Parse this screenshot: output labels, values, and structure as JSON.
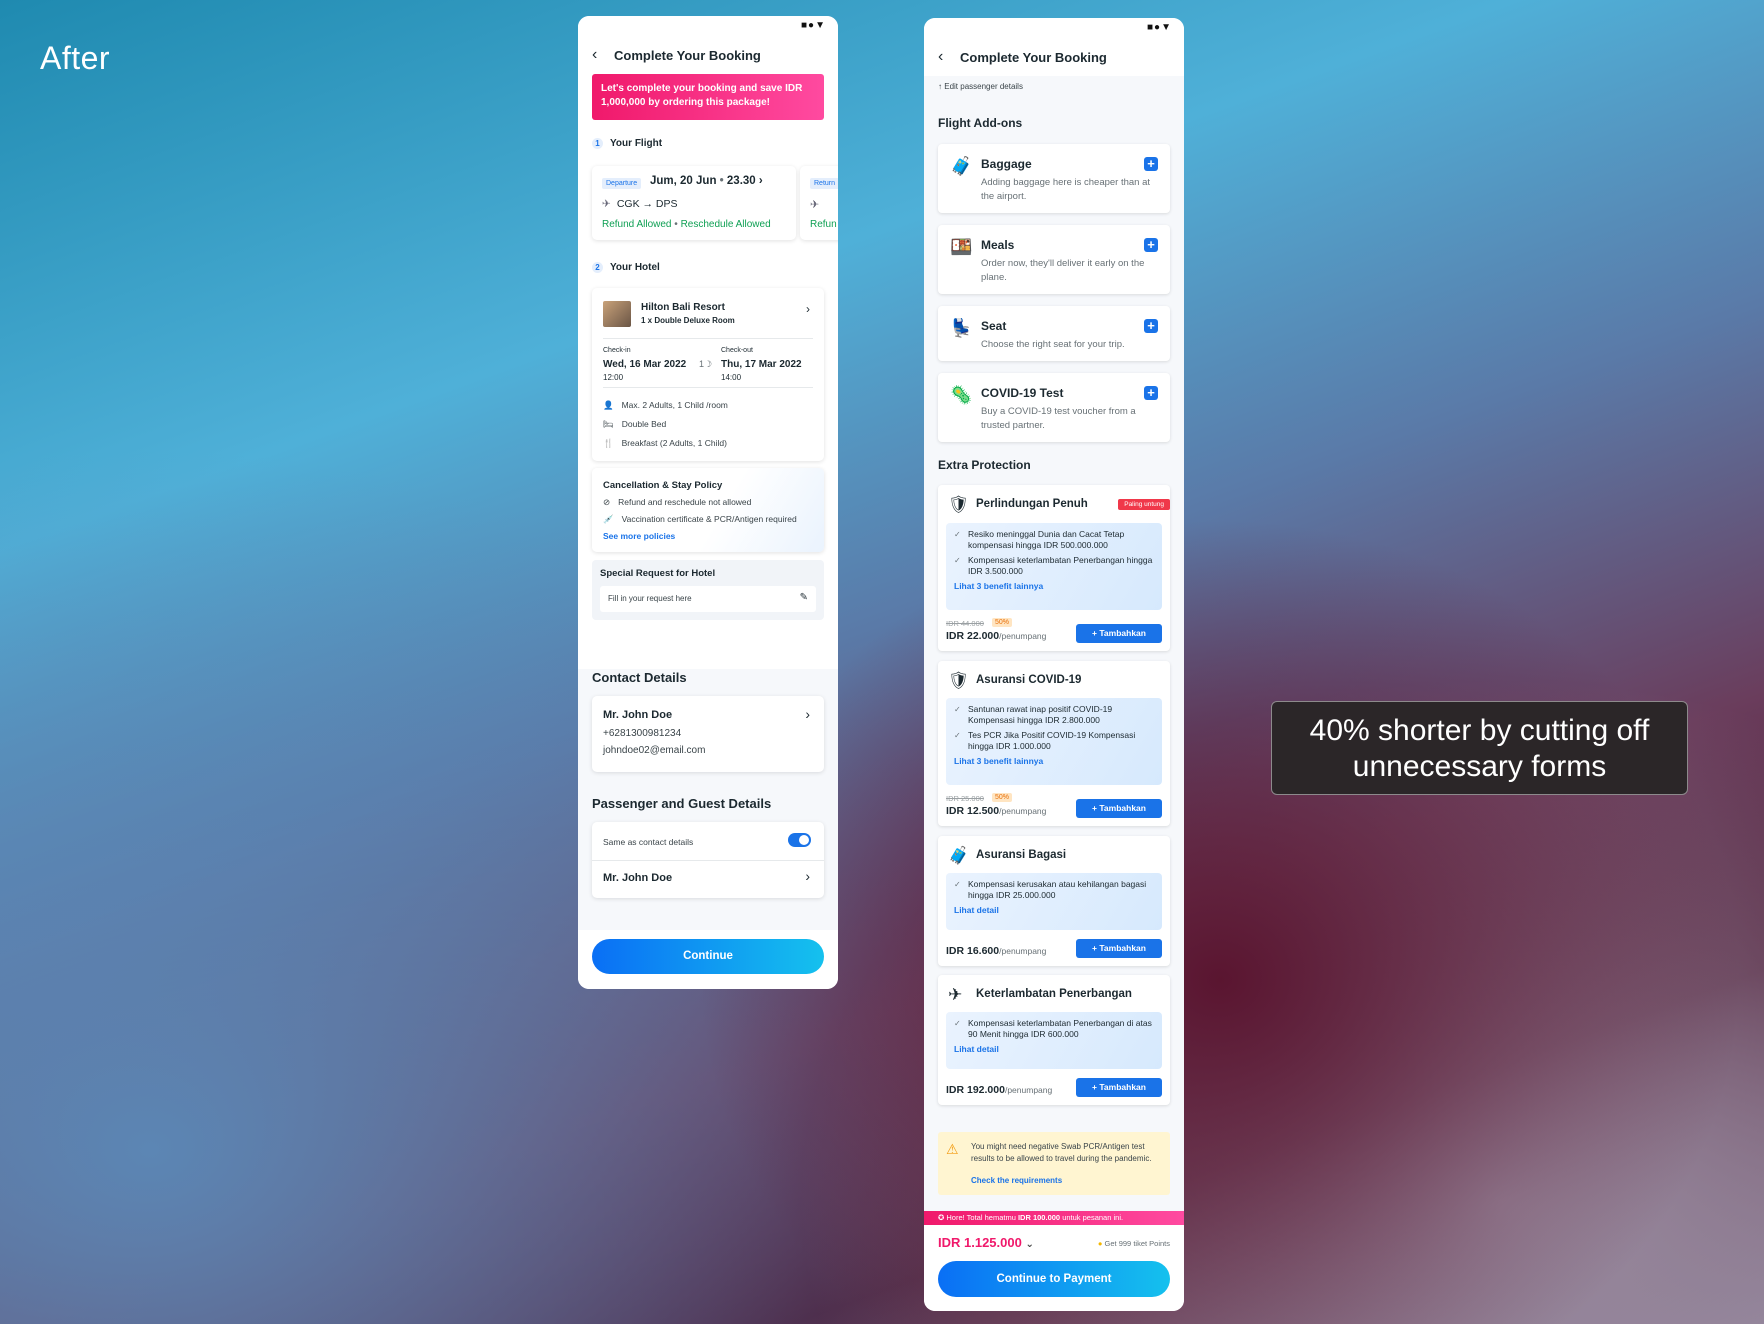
{
  "label_after": "After",
  "callout": "40% shorter by cutting off unnecessary forms",
  "status_icons": "■●▼",
  "screen1": {
    "title": "Complete Your Booking",
    "promo": "Let's complete your booking and save IDR 1,000,000 by ordering this package!",
    "section1_num": "1",
    "section1": "Your Flight",
    "flight": {
      "badge": "Departure",
      "date": "Jum, 20 Jun",
      "time": "23.30",
      "route": "CGK → DPS",
      "refund": "Refund Allowed",
      "reschedule": "Reschedule Allowed",
      "badge2": "Return",
      "refund2": "Refun"
    },
    "section2_num": "2",
    "section2": "Your Hotel",
    "hotel": {
      "name": "Hilton Bali Resort",
      "room": "1 x Double Deluxe Room",
      "checkin_label": "Check-in",
      "checkin_date": "Wed, 16 Mar 2022",
      "checkin_time": "12:00",
      "nights": "1",
      "checkout_label": "Check-out",
      "checkout_date": "Thu, 17 Mar 2022",
      "checkout_time": "14:00",
      "occupancy": "Max. 2 Adults, 1 Child /room",
      "bed": "Double Bed",
      "breakfast": "Breakfast (2 Adults, 1 Child)"
    },
    "policy": {
      "title": "Cancellation & Stay Policy",
      "item1": "Refund and reschedule not allowed",
      "item2": "Vaccination certificate & PCR/Antigen required",
      "link": "See more policies"
    },
    "special": {
      "title": "Special Request for Hotel",
      "placeholder": "Fill in your request here"
    },
    "contact": {
      "title": "Contact Details",
      "name": "Mr. John Doe",
      "phone": "+6281300981234",
      "email": "johndoe02@email.com"
    },
    "passenger": {
      "title": "Passenger and Guest Details",
      "same": "Same as contact details",
      "name": "Mr. John Doe"
    },
    "continue": "Continue"
  },
  "screen2": {
    "title": "Complete Your Booking",
    "edit": "Edit passenger details",
    "addons_title": "Flight Add-ons",
    "addons": [
      {
        "title": "Baggage",
        "desc": "Adding baggage here is cheaper than at the airport."
      },
      {
        "title": "Meals",
        "desc": "Order now, they'll deliver it early on the plane."
      },
      {
        "title": "Seat",
        "desc": "Choose the right seat for your trip."
      },
      {
        "title": "COVID-19 Test",
        "desc": "Buy a COVID-19 test voucher from a trusted partner."
      }
    ],
    "extra_title": "Extra Protection",
    "protections": [
      {
        "title": "Perlindungan Penuh",
        "badge": "Paling untung",
        "b1": "Resiko meninggal Dunia dan Cacat Tetap kompensasi hingga IDR 500.000.000",
        "b2": "Kompensasi keterlambatan Penerbangan hingga IDR 3.500.000",
        "link": "Lihat 3 benefit lainnya",
        "old": "IDR 44.000",
        "disc": "50%",
        "price": "IDR 22.000",
        "unit": "/penumpang",
        "btn": "+ Tambahkan"
      },
      {
        "title": "Asuransi COVID-19",
        "b1": "Santunan rawat inap positif COVID-19 Kompensasi hingga IDR 2.800.000",
        "b2": "Tes PCR Jika Positif COVID-19 Kompensasi hingga IDR 1.000.000",
        "link": "Lihat 3 benefit lainnya",
        "old": "IDR 25.000",
        "disc": "50%",
        "price": "IDR 12.500",
        "unit": "/penumpang",
        "btn": "+ Tambahkan"
      },
      {
        "title": "Asuransi Bagasi",
        "b1": "Kompensasi kerusakan atau kehilangan bagasi hingga IDR 25.000.000",
        "link": "Lihat detail",
        "price": "IDR 16.600",
        "unit": "/penumpang",
        "btn": "+ Tambahkan"
      },
      {
        "title": "Keterlambatan Penerbangan",
        "b1": "Kompensasi keterlambatan Penerbangan di atas 90 Menit hingga IDR 600.000",
        "link": "Lihat detail",
        "price": "IDR 192.000",
        "unit": "/penumpang",
        "btn": "+ Tambahkan"
      }
    ],
    "warning": "You might need negative Swab PCR/Antigen test results to be allowed to travel during the pandemic.",
    "warning_link": "Check the requirements",
    "savings_pre": "Hore! Total hematmu",
    "savings_amt": "IDR 100.000",
    "savings_post": "untuk pesanan ini.",
    "total": "IDR 1.125.000",
    "points": "Get 999 tiket Points",
    "pay": "Continue to Payment"
  },
  "colors": {
    "primary": "#1a73e8",
    "pink": "#f0196b",
    "green": "#0fa054"
  }
}
